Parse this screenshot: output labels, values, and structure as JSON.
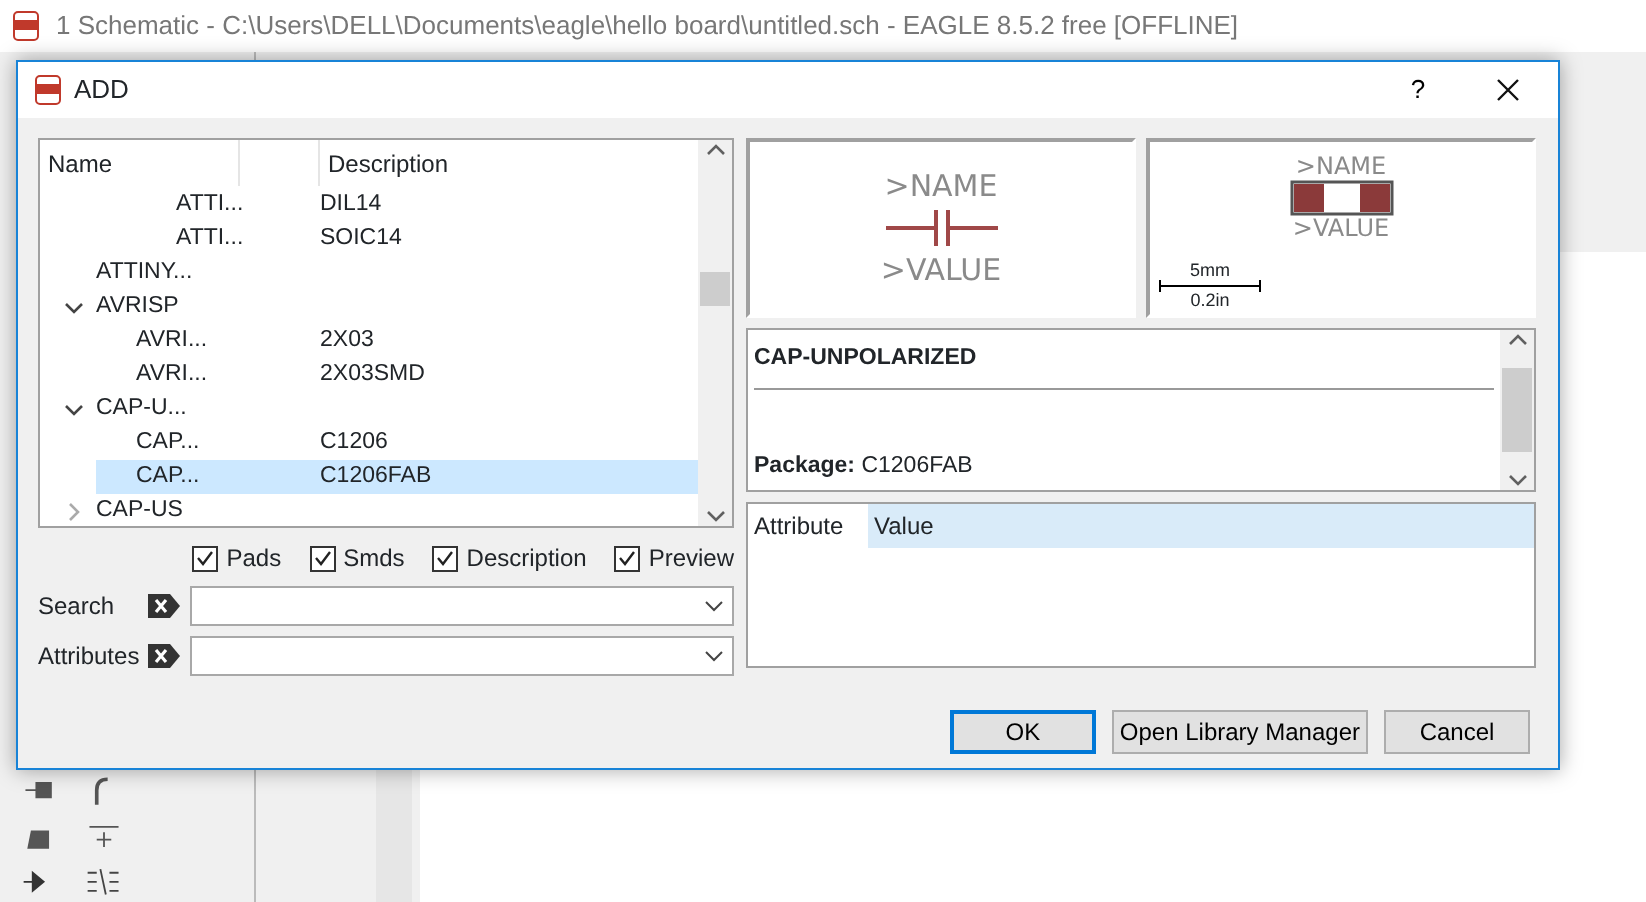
{
  "app_window": {
    "title": "1 Schematic - C:\\Users\\DELL\\Documents\\eagle\\hello board\\untitled.sch - EAGLE 8.5.2 free [OFFLINE]"
  },
  "dialog": {
    "title": "ADD",
    "help": "?",
    "tree": {
      "columns": [
        "Name",
        "Description"
      ],
      "items": [
        {
          "children": [
            {
              "name": "ATTI...",
              "description": "DIL14",
              "selected": false
            },
            {
              "name": "ATTI...",
              "description": "SOIC14",
              "selected": false
            }
          ]
        },
        {
          "name": "ATTINY...",
          "selected": false
        },
        {
          "name": "AVRISP",
          "expanded": true,
          "selected": false,
          "children": [
            {
              "name": "AVRI...",
              "description": "2X03",
              "selected": false
            },
            {
              "name": "AVRI...",
              "description": "2X03SMD",
              "selected": false
            }
          ]
        },
        {
          "name": "CAP-U...",
          "expanded": true,
          "selected": false,
          "children": [
            {
              "name": "CAP...",
              "description": "C1206",
              "selected": false
            },
            {
              "name": "CAP...",
              "description": "C1206FAB",
              "selected": true
            }
          ]
        },
        {
          "name": "CAP-US",
          "expanded": false,
          "selected": false
        }
      ]
    },
    "filters": [
      {
        "label": "Pads",
        "checked": true
      },
      {
        "label": "Smds",
        "checked": true
      },
      {
        "label": "Description",
        "checked": true
      },
      {
        "label": "Preview",
        "checked": true
      }
    ],
    "fields": [
      {
        "label": "Search"
      },
      {
        "label": "Attributes"
      }
    ],
    "symbol_preview": {
      "name": ">NAME",
      "value": ">VALUE"
    },
    "package_preview": {
      "name": ">NAME",
      "value": ">VALUE",
      "scale_top": "5mm",
      "scale_bottom": "0.2in"
    },
    "description": {
      "title": "CAP-UNPOLARIZED",
      "package_label": "Package:",
      "package": "C1206FAB"
    },
    "attributes": {
      "columns": [
        "Attribute",
        "Value"
      ]
    },
    "buttons": [
      {
        "label": "OK",
        "default": true
      },
      {
        "label": "Open Library Manager",
        "default": false
      },
      {
        "label": "Cancel",
        "default": false
      }
    ]
  }
}
